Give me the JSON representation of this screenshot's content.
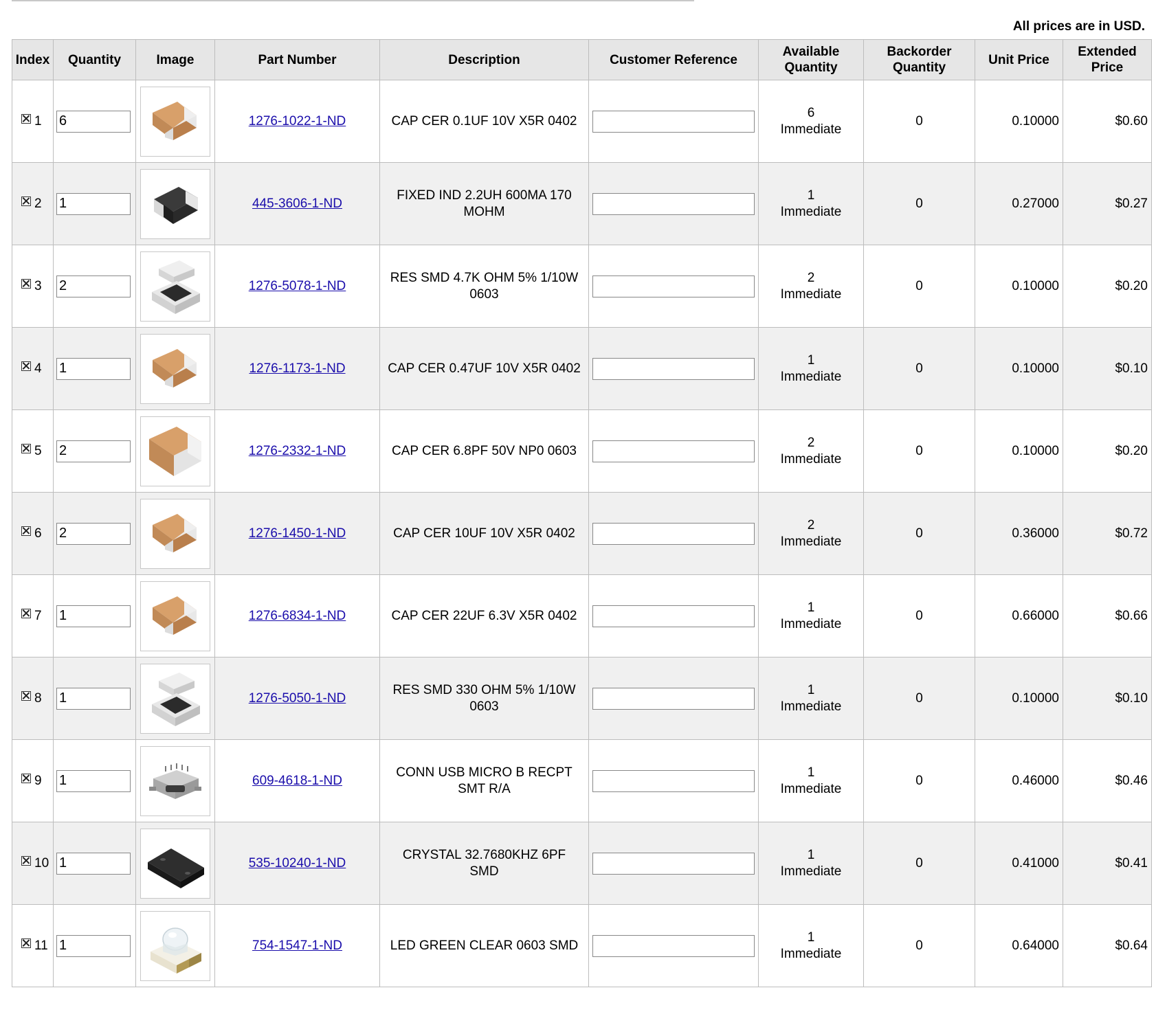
{
  "page": {
    "price_note": "All prices are in USD."
  },
  "table": {
    "headers": {
      "index": "Index",
      "quantity": "Quantity",
      "image": "Image",
      "part_number": "Part Number",
      "description": "Description",
      "customer_reference": "Customer Reference",
      "available_quantity_line1": "Available",
      "available_quantity_line2": "Quantity",
      "backorder_quantity_line1": "Backorder",
      "backorder_quantity_line2": "Quantity",
      "unit_price": "Unit Price",
      "extended_price_line1": "Extended",
      "extended_price_line2": "Price"
    },
    "rows": [
      {
        "index": "1",
        "quantity": "6",
        "image_icon": "ceramic-capacitor-icon",
        "part_number": "1276-1022-1-ND",
        "description": "CAP CER 0.1UF 10V X5R 0402",
        "customer_reference": "",
        "available_qty": "6",
        "available_status": "Immediate",
        "backorder_qty": "0",
        "unit_price": "0.10000",
        "extended_price": "$0.60"
      },
      {
        "index": "2",
        "quantity": "1",
        "image_icon": "inductor-icon",
        "part_number": "445-3606-1-ND",
        "description": "FIXED IND 2.2UH 600MA 170 MOHM",
        "customer_reference": "",
        "available_qty": "1",
        "available_status": "Immediate",
        "backorder_qty": "0",
        "unit_price": "0.27000",
        "extended_price": "$0.27"
      },
      {
        "index": "3",
        "quantity": "2",
        "image_icon": "smd-resistor-icon",
        "part_number": "1276-5078-1-ND",
        "description": "RES SMD 4.7K OHM 5% 1/10W 0603",
        "customer_reference": "",
        "available_qty": "2",
        "available_status": "Immediate",
        "backorder_qty": "0",
        "unit_price": "0.10000",
        "extended_price": "$0.20"
      },
      {
        "index": "4",
        "quantity": "1",
        "image_icon": "ceramic-capacitor-icon",
        "part_number": "1276-1173-1-ND",
        "description": "CAP CER 0.47UF 10V X5R 0402",
        "customer_reference": "",
        "available_qty": "1",
        "available_status": "Immediate",
        "backorder_qty": "0",
        "unit_price": "0.10000",
        "extended_price": "$0.10"
      },
      {
        "index": "5",
        "quantity": "2",
        "image_icon": "ceramic-capacitor-large-icon",
        "part_number": "1276-2332-1-ND",
        "description": "CAP CER 6.8PF 50V NP0 0603",
        "customer_reference": "",
        "available_qty": "2",
        "available_status": "Immediate",
        "backorder_qty": "0",
        "unit_price": "0.10000",
        "extended_price": "$0.20"
      },
      {
        "index": "6",
        "quantity": "2",
        "image_icon": "ceramic-capacitor-icon",
        "part_number": "1276-1450-1-ND",
        "description": "CAP CER 10UF 10V X5R 0402",
        "customer_reference": "",
        "available_qty": "2",
        "available_status": "Immediate",
        "backorder_qty": "0",
        "unit_price": "0.36000",
        "extended_price": "$0.72"
      },
      {
        "index": "7",
        "quantity": "1",
        "image_icon": "ceramic-capacitor-icon",
        "part_number": "1276-6834-1-ND",
        "description": "CAP CER 22UF 6.3V X5R 0402",
        "customer_reference": "",
        "available_qty": "1",
        "available_status": "Immediate",
        "backorder_qty": "0",
        "unit_price": "0.66000",
        "extended_price": "$0.66"
      },
      {
        "index": "8",
        "quantity": "1",
        "image_icon": "smd-resistor-icon",
        "part_number": "1276-5050-1-ND",
        "description": "RES SMD 330 OHM 5% 1/10W 0603",
        "customer_reference": "",
        "available_qty": "1",
        "available_status": "Immediate",
        "backorder_qty": "0",
        "unit_price": "0.10000",
        "extended_price": "$0.10"
      },
      {
        "index": "9",
        "quantity": "1",
        "image_icon": "usb-connector-icon",
        "part_number": "609-4618-1-ND",
        "description": "CONN USB MICRO B RECPT SMT R/A",
        "customer_reference": "",
        "available_qty": "1",
        "available_status": "Immediate",
        "backorder_qty": "0",
        "unit_price": "0.46000",
        "extended_price": "$0.46"
      },
      {
        "index": "10",
        "quantity": "1",
        "image_icon": "crystal-icon",
        "part_number": "535-10240-1-ND",
        "description": "CRYSTAL 32.7680KHZ 6PF SMD",
        "customer_reference": "",
        "available_qty": "1",
        "available_status": "Immediate",
        "backorder_qty": "0",
        "unit_price": "0.41000",
        "extended_price": "$0.41"
      },
      {
        "index": "11",
        "quantity": "1",
        "image_icon": "led-icon",
        "part_number": "754-1547-1-ND",
        "description": "LED GREEN CLEAR 0603 SMD",
        "customer_reference": "",
        "available_qty": "1",
        "available_status": "Immediate",
        "backorder_qty": "0",
        "unit_price": "0.64000",
        "extended_price": "$0.64"
      }
    ]
  }
}
